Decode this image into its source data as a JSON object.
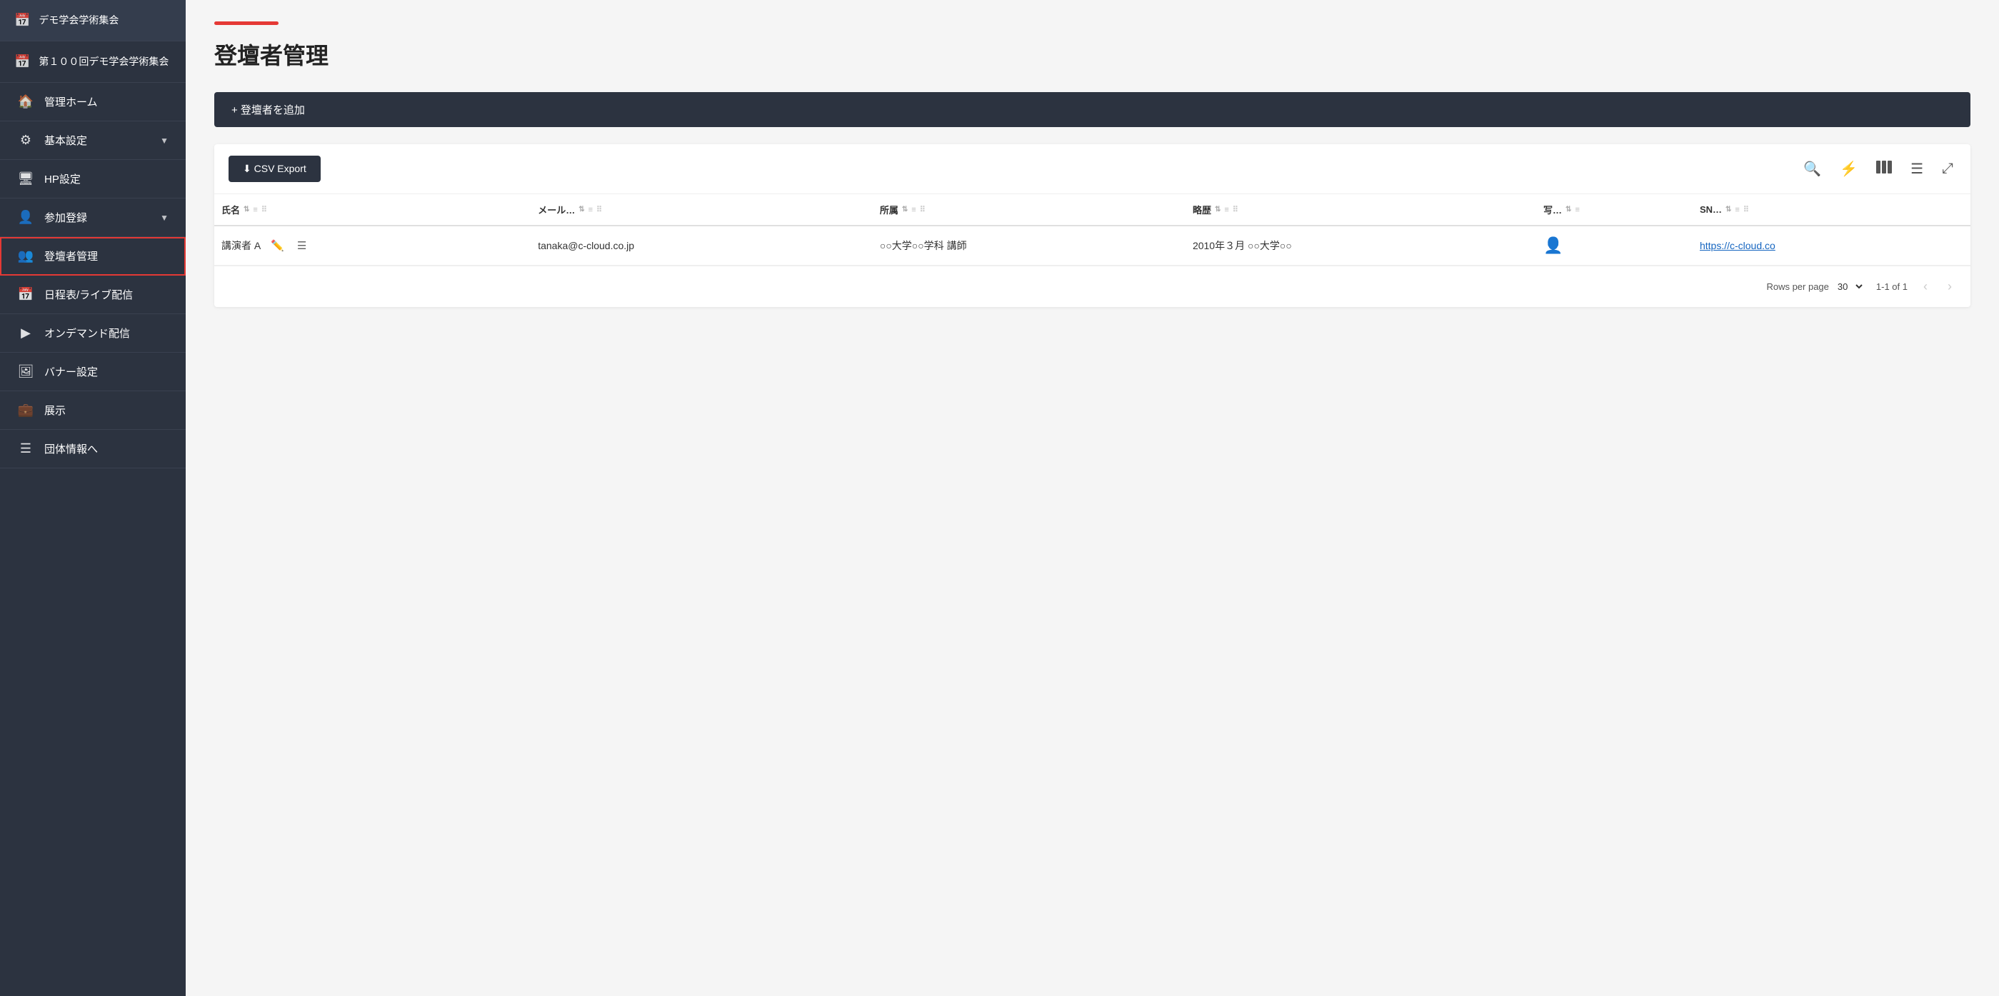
{
  "sidebar": {
    "top_items": [
      {
        "id": "demo-gakkai",
        "label": "デモ学会学術集会",
        "icon": "📅"
      },
      {
        "id": "dai100",
        "label": "第１００回デモ学会学術集会",
        "icon": "📅"
      }
    ],
    "nav_items": [
      {
        "id": "kanri-home",
        "label": "管理ホーム",
        "icon": "🏠",
        "has_chevron": false,
        "active": false
      },
      {
        "id": "kihon-settei",
        "label": "基本設定",
        "icon": "⚙️",
        "has_chevron": true,
        "active": false
      },
      {
        "id": "hp-settei",
        "label": "HP設定",
        "icon": "🖥",
        "has_chevron": false,
        "active": false
      },
      {
        "id": "sanka-toroku",
        "label": "参加登録",
        "icon": "👤",
        "has_chevron": true,
        "active": false
      },
      {
        "id": "todan-kanri",
        "label": "登壇者管理",
        "icon": "👥",
        "has_chevron": false,
        "active": true
      },
      {
        "id": "nittei",
        "label": "日程表/ライブ配信",
        "icon": "📅",
        "has_chevron": false,
        "active": false
      },
      {
        "id": "ondemand",
        "label": "オンデマンド配信",
        "icon": "▶️",
        "has_chevron": false,
        "active": false
      },
      {
        "id": "banner",
        "label": "バナー設定",
        "icon": "🖼",
        "has_chevron": false,
        "active": false
      },
      {
        "id": "tenji",
        "label": "展示",
        "icon": "💼",
        "has_chevron": false,
        "active": false
      },
      {
        "id": "dantai",
        "label": "団体情報へ",
        "icon": "☰",
        "has_chevron": false,
        "active": false
      }
    ]
  },
  "page": {
    "title": "登壇者管理",
    "add_button_label": "+ 登壇者を追加",
    "csv_export_label": "⬇ CSV Export"
  },
  "toolbar": {
    "icons": [
      {
        "id": "search",
        "symbol": "🔍"
      },
      {
        "id": "filter",
        "symbol": "⚡"
      },
      {
        "id": "columns",
        "symbol": "⊞"
      },
      {
        "id": "menu",
        "symbol": "☰"
      },
      {
        "id": "fullscreen",
        "symbol": "⤢"
      }
    ]
  },
  "table": {
    "columns": [
      {
        "id": "name",
        "label": "氏名"
      },
      {
        "id": "email",
        "label": "メール…"
      },
      {
        "id": "affiliation",
        "label": "所属"
      },
      {
        "id": "bio",
        "label": "略歴"
      },
      {
        "id": "photo",
        "label": "写…"
      },
      {
        "id": "sn",
        "label": "SN…"
      }
    ],
    "rows": [
      {
        "name": "講演者 A",
        "email": "tanaka@c-cloud.co.jp",
        "affiliation": "○○大学○○学科 講師",
        "bio": "2010年３月 ○○大学○○",
        "photo": "avatar",
        "sn_url": "https://c-cloud.co"
      }
    ]
  },
  "pagination": {
    "rows_per_page_label": "Rows per page",
    "rows_per_page_value": "30",
    "page_info": "1-1 of 1"
  }
}
